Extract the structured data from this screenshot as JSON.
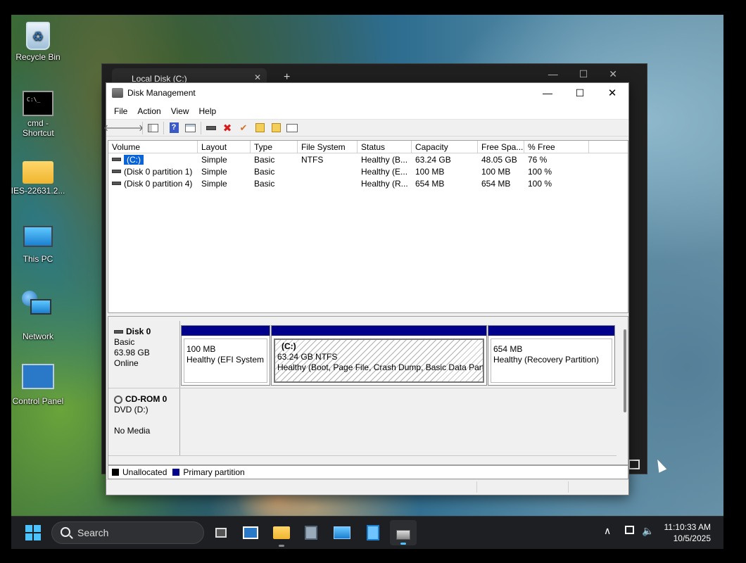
{
  "desktop": {
    "icons": [
      {
        "label": "Recycle Bin",
        "icon": "recycle-bin-icon"
      },
      {
        "label": "cmd - Shortcut",
        "icon": "cmd-icon"
      },
      {
        "label": "IES-22631.2...",
        "icon": "folder-icon"
      },
      {
        "label": "This PC",
        "icon": "this-pc-icon"
      },
      {
        "label": "Network",
        "icon": "network-icon"
      },
      {
        "label": "Control Panel",
        "icon": "control-panel-icon"
      }
    ]
  },
  "explorer": {
    "tab_title": "Local Disk (C:)",
    "tab_close": "✕",
    "new_tab": "+"
  },
  "window": {
    "title": "Disk Management",
    "minimize": "—",
    "maximize": "☐",
    "close": "✕"
  },
  "menu": [
    "File",
    "Action",
    "View",
    "Help"
  ],
  "toolbar": {
    "back": "🡐",
    "forward": "🡒",
    "delete": "✖",
    "check": "✔"
  },
  "volumes": {
    "columns": [
      "Volume",
      "Layout",
      "Type",
      "File System",
      "Status",
      "Capacity",
      "Free Spa...",
      "% Free"
    ],
    "rows": [
      {
        "volume": "(C:)",
        "layout": "Simple",
        "type": "Basic",
        "fs": "NTFS",
        "status": "Healthy (B...",
        "capacity": "63.24 GB",
        "free": "48.05 GB",
        "pct": "76 %"
      },
      {
        "volume": "(Disk 0 partition 1)",
        "layout": "Simple",
        "type": "Basic",
        "fs": "",
        "status": "Healthy (E...",
        "capacity": "100 MB",
        "free": "100 MB",
        "pct": "100 %"
      },
      {
        "volume": "(Disk 0 partition 4)",
        "layout": "Simple",
        "type": "Basic",
        "fs": "",
        "status": "Healthy (R...",
        "capacity": "654 MB",
        "free": "654 MB",
        "pct": "100 %"
      }
    ]
  },
  "disks": [
    {
      "name": "Disk 0",
      "kind": "Basic",
      "size": "63.98 GB",
      "state": "Online",
      "partitions": [
        {
          "title": "",
          "size": "100 MB",
          "status": "Healthy (EFI System P"
        },
        {
          "title": "(C:)",
          "size": "63.24 GB NTFS",
          "status": "Healthy (Boot, Page File, Crash Dump, Basic Data Partitio"
        },
        {
          "title": "",
          "size": "654 MB",
          "status": "Healthy (Recovery Partition)"
        }
      ]
    },
    {
      "name": "CD-ROM 0",
      "kind": "DVD (D:)",
      "state": "No Media"
    }
  ],
  "legend": [
    {
      "label": "Unallocated",
      "color": "#000000"
    },
    {
      "label": "Primary partition",
      "color": "#00008b"
    }
  ],
  "taskbar": {
    "search_placeholder": "Search",
    "time": "11:10:33 AM",
    "date": "10/5/2025",
    "tray_chevron": "∧"
  }
}
